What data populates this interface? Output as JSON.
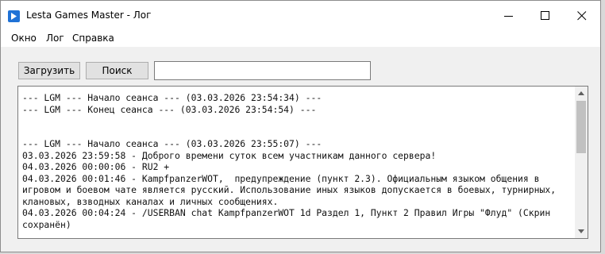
{
  "window": {
    "title": "Lesta Games Master - Лог"
  },
  "menu": {
    "items": [
      "Окно",
      "Лог",
      "Справка"
    ]
  },
  "toolbar": {
    "load_label": "Загрузить",
    "search_label": "Поиск",
    "search_value": ""
  },
  "log": {
    "lines": [
      "--- LGM --- Начало сеанса --- (03.03.2026 23:54:34) ---",
      "--- LGM --- Конец сеанса --- (03.03.2026 23:54:54) ---",
      "",
      "",
      "--- LGM --- Начало сеанса --- (03.03.2026 23:55:07) ---",
      "03.03.2026 23:59:58 - Доброго времени суток всем участникам данного сервера!",
      "04.03.2026 00:00:06 - RU2 +",
      "04.03.2026 00:01:46 - KampfpanzerWOT,  предупреждение (пункт 2.3). Официальным языком общения в",
      "игровом и боевом чате является русский. Использование иных языков допускается в боевых, турнирных,",
      "клановых, взводных каналах и личных сообщениях.",
      "04.03.2026 00:04:24 - /USERBAN chat KampfpanzerWOT 1d Раздел 1, Пункт 2 Правил Игры \"Флуд\" (Скрин",
      "сохранён)"
    ]
  },
  "icons": {
    "app": "app-icon",
    "minimize": "minimize-icon",
    "maximize": "maximize-icon",
    "close": "close-icon"
  },
  "colors": {
    "app_icon": "#1f72d6",
    "titlebar": "#ffffff",
    "window_bg": "#f0f0f0"
  }
}
